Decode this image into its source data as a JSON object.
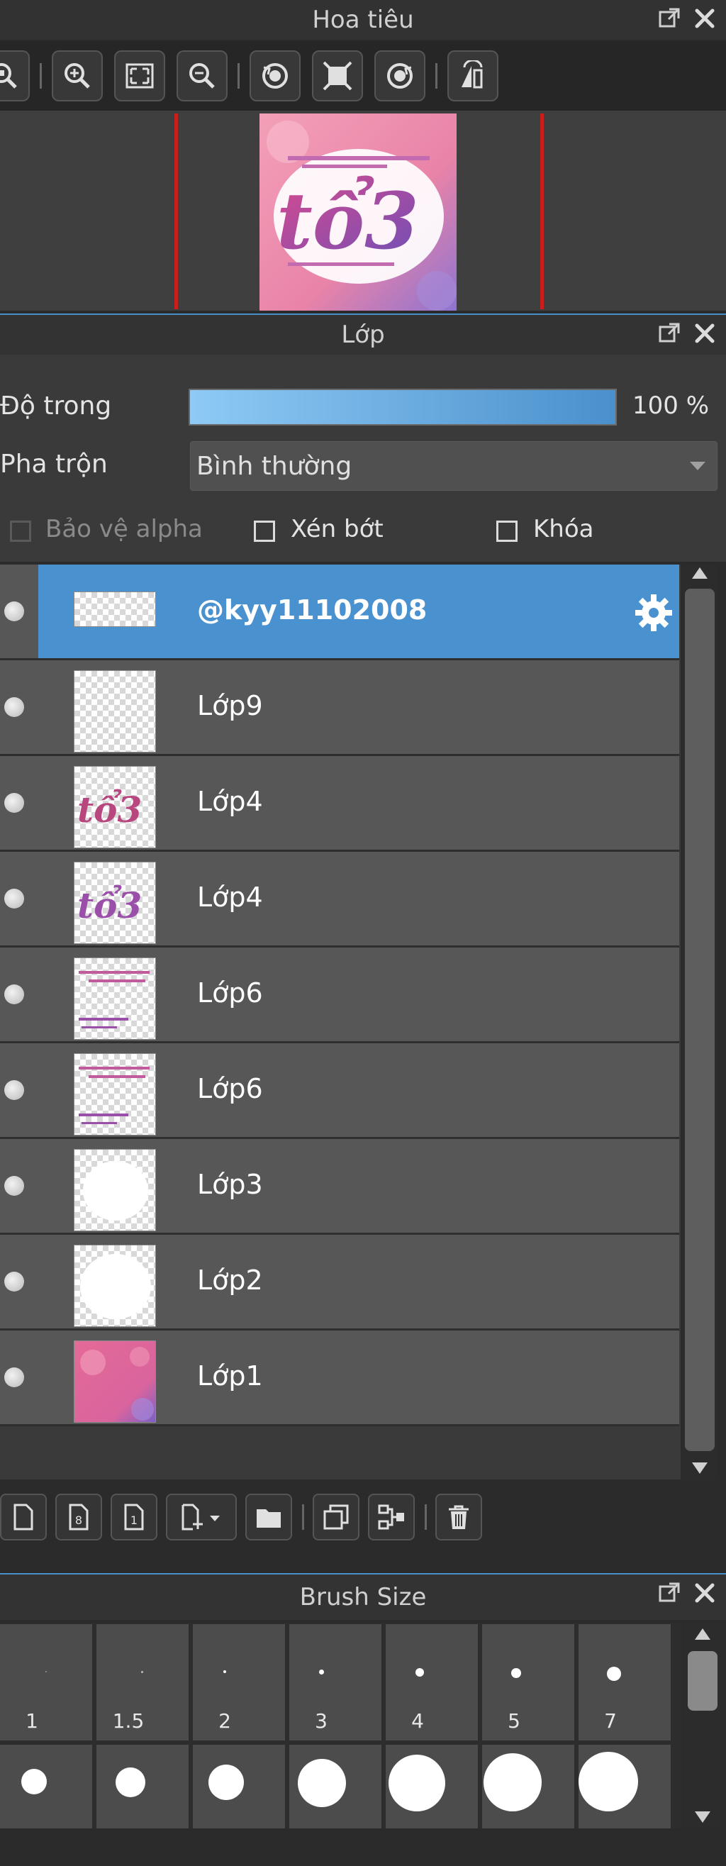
{
  "navigator": {
    "title": "Hoa tiêu",
    "toolbar": [
      "zoom-fit-icon",
      "zoom-in-icon",
      "fit-screen-icon",
      "zoom-out-icon",
      "rotate-left-icon",
      "reset-rotation-icon",
      "rotate-right-icon",
      "flip-horizontal-icon"
    ]
  },
  "layers": {
    "title": "Lớp",
    "opacity_label": "Độ trong",
    "opacity_value": "100 %",
    "opacity_fraction": 1.0,
    "blend_label": "Pha trộn",
    "blend_value": "Bình thường",
    "protect_alpha_label": "Bảo vệ alpha",
    "clipping_label": "Xén bớt",
    "lock_label": "Khóa",
    "items": [
      {
        "name": "@kyy11102008",
        "selected": true
      },
      {
        "name": "Lớp9"
      },
      {
        "name": "Lớp4"
      },
      {
        "name": "Lớp4"
      },
      {
        "name": "Lớp6"
      },
      {
        "name": "Lớp6"
      },
      {
        "name": "Lớp3"
      },
      {
        "name": "Lớp2"
      },
      {
        "name": "Lớp1"
      }
    ],
    "thumb_text": "tổ3"
  },
  "brush_size": {
    "title": "Brush Size",
    "row1": [
      "1",
      "1.5",
      "2",
      "3",
      "4",
      "5",
      "7"
    ]
  },
  "colors": {
    "accent": "#4a92cf",
    "panel": "#3a3a3a",
    "row": "#575757",
    "canvas_red_line": "#c81e1e"
  }
}
